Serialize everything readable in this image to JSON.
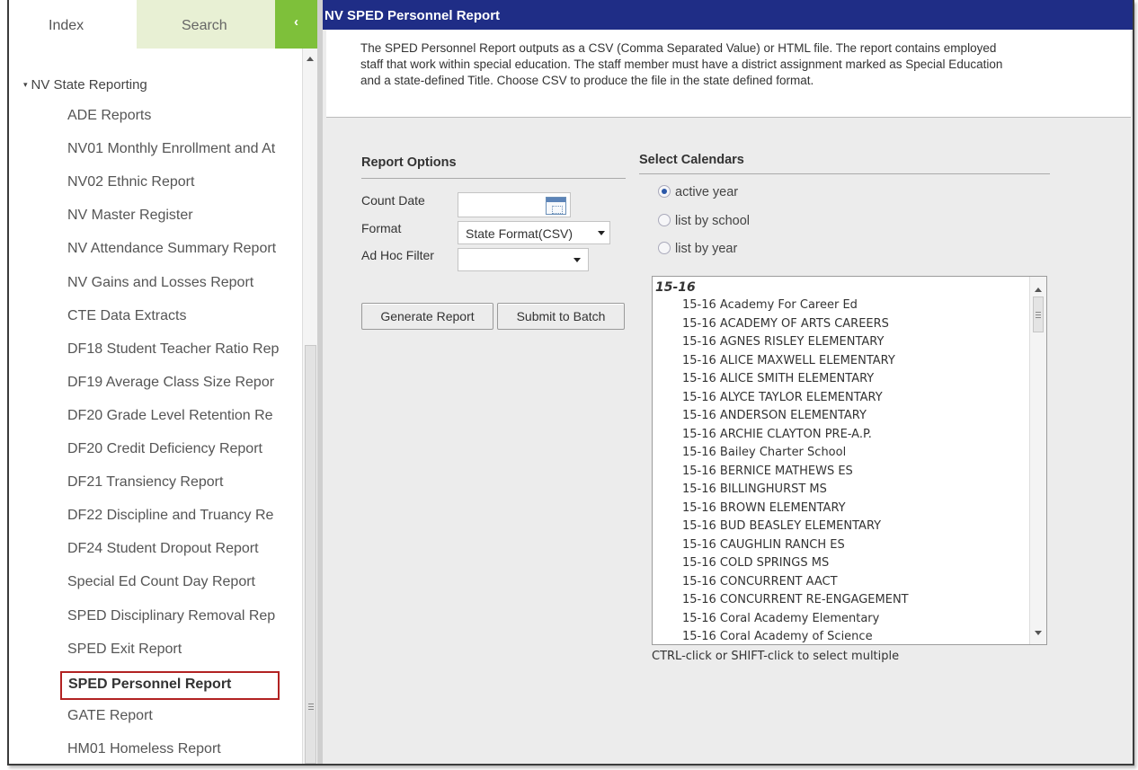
{
  "sidebar": {
    "tabs": {
      "index": "Index",
      "search": "Search",
      "collapse": "‹"
    },
    "section": {
      "caret": "▾",
      "label": "NV State Reporting"
    },
    "items": [
      "ADE Reports",
      "NV01 Monthly Enrollment and At",
      "NV02 Ethnic Report",
      "NV Master Register",
      "NV Attendance Summary Report",
      "NV Gains and Losses Report",
      "CTE Data Extracts",
      "DF18 Student Teacher Ratio Rep",
      "DF19 Average Class Size Repor",
      "DF20 Grade Level Retention Re",
      "DF20 Credit Deficiency Report",
      "DF21 Transiency Report",
      "DF22 Discipline and Truancy Re",
      "DF24 Student Dropout Report",
      "Special Ed Count Day Report",
      "SPED Disciplinary Removal Rep",
      "SPED Exit Report",
      "SPED Personnel Report",
      "GATE Report",
      "HM01 Homeless Report"
    ],
    "selected_index": 17
  },
  "main": {
    "title": "NV SPED Personnel Report",
    "description_lines": [
      "The SPED Personnel Report outputs as a CSV (Comma Separated Value) or HTML file. The report contains employed",
      "staff that work within special education. The staff member must have a district assignment marked as Special Education",
      "and a state-defined Title. Choose CSV to produce the file in the state defined format."
    ]
  },
  "report_options": {
    "heading": "Report Options",
    "count_date_label": "Count Date",
    "count_date_value": "",
    "format_label": "Format",
    "format_value": "State Format(CSV)",
    "ad_hoc_label": "Ad Hoc Filter",
    "ad_hoc_value": "",
    "generate_button": "Generate Report",
    "batch_button": "Submit to Batch"
  },
  "calendars": {
    "heading": "Select Calendars",
    "radios": [
      {
        "label": "active year",
        "checked": true
      },
      {
        "label": "list by school",
        "checked": false
      },
      {
        "label": "list by year",
        "checked": false
      }
    ],
    "group": "15-16",
    "items": [
      "15-16 Academy For Career Ed",
      "15-16 ACADEMY OF ARTS CAREERS",
      "15-16 AGNES RISLEY ELEMENTARY",
      "15-16 ALICE MAXWELL ELEMENTARY",
      "15-16 ALICE SMITH ELEMENTARY",
      "15-16 ALYCE TAYLOR ELEMENTARY",
      "15-16 ANDERSON ELEMENTARY",
      "15-16 ARCHIE CLAYTON PRE-A.P.",
      "15-16 Bailey Charter School",
      "15-16 BERNICE MATHEWS ES",
      "15-16 BILLINGHURST MS",
      "15-16 BROWN ELEMENTARY",
      "15-16 BUD BEASLEY ELEMENTARY",
      "15-16 CAUGHLIN RANCH ES",
      "15-16 COLD SPRINGS MS",
      "15-16 CONCURRENT AACT",
      "15-16 CONCURRENT RE-ENGAGEMENT",
      "15-16 Coral Academy Elementary",
      "15-16 Coral Academy of Science"
    ],
    "hint": "CTRL-click or SHIFT-click to select multiple"
  },
  "colors": {
    "title_bar": "#1f2d86",
    "collapse_button": "#7ec03a",
    "search_tab": "#e8f0d4",
    "selected_outline": "#b22222"
  }
}
